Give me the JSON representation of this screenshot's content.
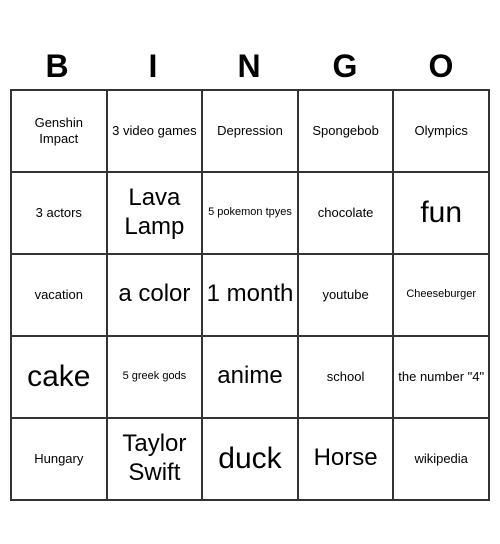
{
  "header": {
    "letters": [
      "B",
      "I",
      "N",
      "G",
      "O"
    ]
  },
  "cells": [
    {
      "text": "Genshin Impact",
      "size": "normal"
    },
    {
      "text": "3 video games",
      "size": "normal"
    },
    {
      "text": "Depression",
      "size": "normal"
    },
    {
      "text": "Spongebob",
      "size": "normal"
    },
    {
      "text": "Olympics",
      "size": "normal"
    },
    {
      "text": "3 actors",
      "size": "normal"
    },
    {
      "text": "Lava Lamp",
      "size": "large"
    },
    {
      "text": "5 pokemon tpyes",
      "size": "small"
    },
    {
      "text": "chocolate",
      "size": "normal"
    },
    {
      "text": "fun",
      "size": "xlarge"
    },
    {
      "text": "vacation",
      "size": "normal"
    },
    {
      "text": "a color",
      "size": "large"
    },
    {
      "text": "1 month",
      "size": "large"
    },
    {
      "text": "youtube",
      "size": "normal"
    },
    {
      "text": "Cheeseburger",
      "size": "small"
    },
    {
      "text": "cake",
      "size": "xlarge"
    },
    {
      "text": "5 greek gods",
      "size": "small"
    },
    {
      "text": "anime",
      "size": "large"
    },
    {
      "text": "school",
      "size": "normal"
    },
    {
      "text": "the number \"4\"",
      "size": "normal"
    },
    {
      "text": "Hungary",
      "size": "normal"
    },
    {
      "text": "Taylor Swift",
      "size": "large"
    },
    {
      "text": "duck",
      "size": "xlarge"
    },
    {
      "text": "Horse",
      "size": "large"
    },
    {
      "text": "wikipedia",
      "size": "normal"
    }
  ]
}
